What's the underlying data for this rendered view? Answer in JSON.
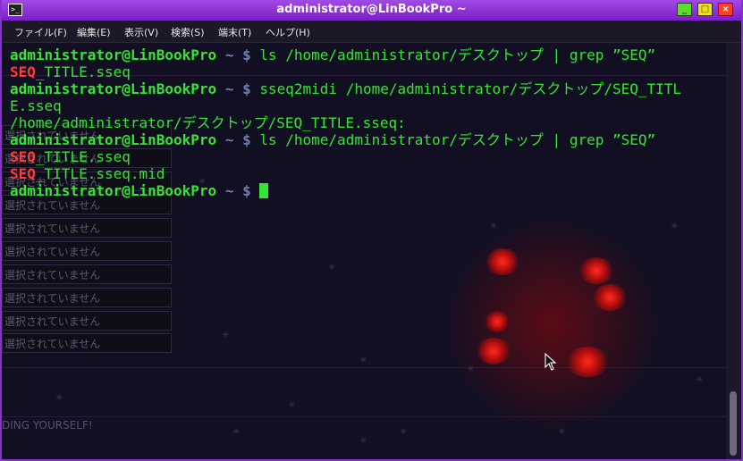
{
  "window": {
    "title": "administrator@LinBookPro ~",
    "min_label": "_",
    "max_label": "□",
    "close_label": "×"
  },
  "menu": [
    "ファイル(F)",
    "編集(E)",
    "表示(V)",
    "検索(S)",
    "端末(T)",
    "ヘルプ(H)"
  ],
  "terminal": {
    "prompt_user": "administrator@LinBookPro",
    "prompt_path": " ~ ",
    "prompt_symbol": "$ ",
    "cmd1": "ls /home/administrator/デスクトップ | grep ”SEQ”",
    "out1_red": "SEQ",
    "out1_rest": "_TITLE.sseq",
    "cmd2": "sseq2midi /home/administrator/デスクトップ/SEQ_TITL",
    "cmd2_wrap": "E.sseq",
    "out2": "/home/administrator/デスクトップ/SEQ_TITLE.sseq:",
    "cmd3": "ls /home/administrator/デスクトップ | grep ”SEQ”",
    "out3a_red": "SEQ",
    "out3a_rest": "_TITLE.sseq",
    "out3b_red": "SEQ",
    "out3b_rest": "_TITLE.sseq.mid"
  },
  "background": {
    "box_label": "選択されていません",
    "tagline": "DING YOURSELF!"
  },
  "colors": {
    "prompt": "#32e632",
    "highlight": "#ff3b3b",
    "title_bar": "#8a2fd0"
  }
}
